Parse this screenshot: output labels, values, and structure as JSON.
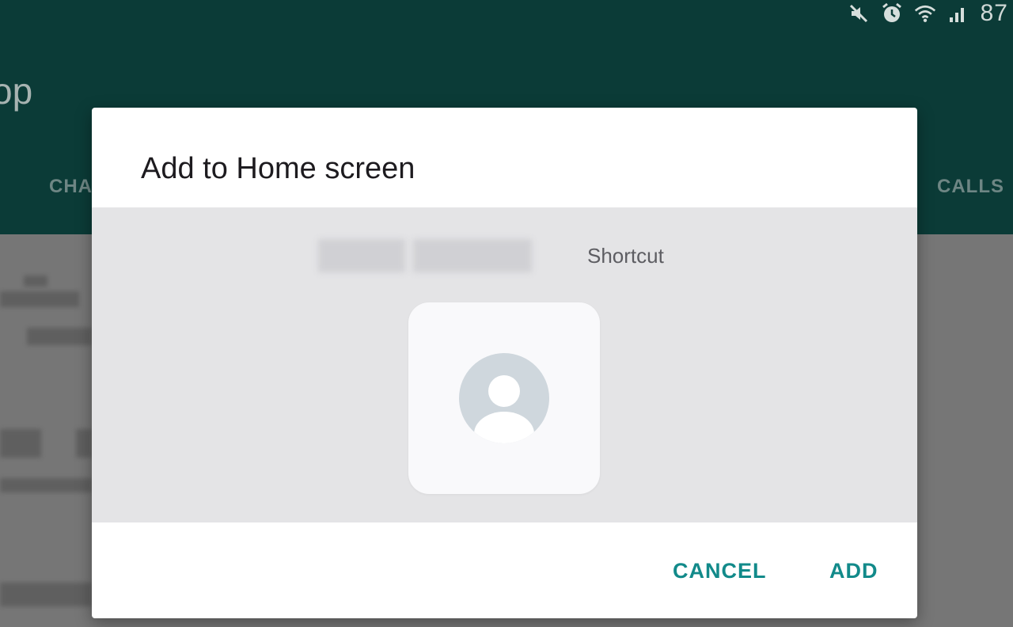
{
  "status_bar": {
    "icons": [
      "mute-icon",
      "alarm-icon",
      "wifi-icon",
      "signal-icon"
    ],
    "battery_text": "87"
  },
  "background_app": {
    "title_fragment": "op",
    "tab_left_fragment": "CHA",
    "tab_right_fragment": "CALLS",
    "header_color": "#0b3b37"
  },
  "dialog": {
    "title": "Add to Home screen",
    "shortcut_label": "Shortcut",
    "icon": "contact-avatar-icon",
    "actions": {
      "cancel": "CANCEL",
      "add": "ADD"
    },
    "accent_color": "#128a8a"
  }
}
